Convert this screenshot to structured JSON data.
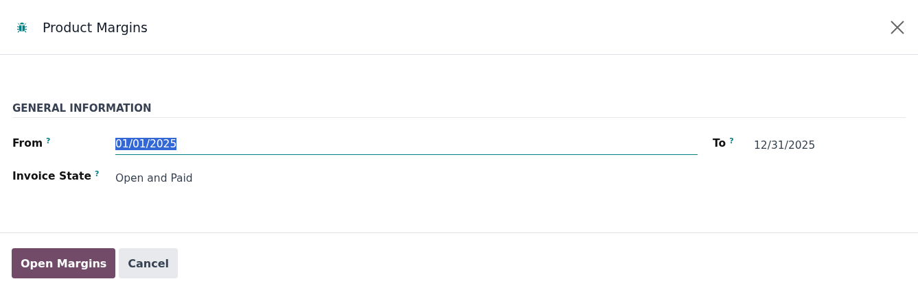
{
  "dialog": {
    "title": "Product Margins"
  },
  "section": {
    "title": "GENERAL INFORMATION"
  },
  "fields": [
    {
      "label": "From",
      "help": "?",
      "value": "01/01/2025",
      "kind": "input",
      "focused": true,
      "text_selected": true
    },
    {
      "label": "To",
      "help": "?",
      "value": "12/31/2025",
      "kind": "text"
    },
    {
      "label": "Invoice State",
      "help": "?",
      "value": "Open and Paid",
      "kind": "text"
    }
  ],
  "buttons": [
    {
      "label": "Open Margins",
      "kind": "primary"
    },
    {
      "label": "Cancel",
      "kind": "secondary"
    }
  ]
}
